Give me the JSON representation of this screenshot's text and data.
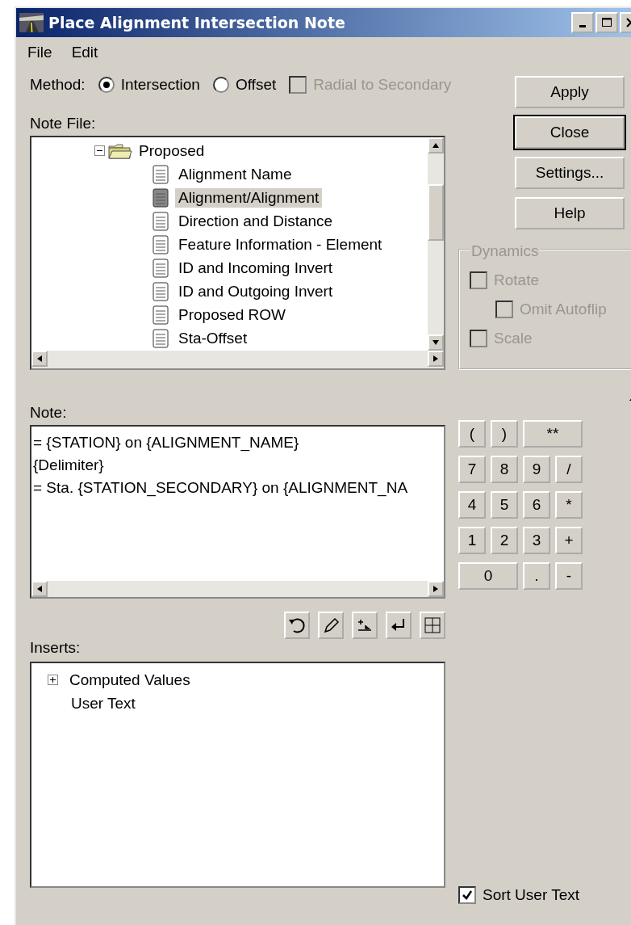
{
  "window": {
    "title": "Place Alignment Intersection Note"
  },
  "menu": [
    "File",
    "Edit"
  ],
  "method": {
    "label": "Method:",
    "options": [
      {
        "label": "Intersection",
        "selected": true
      },
      {
        "label": "Offset",
        "selected": false
      }
    ],
    "radial": {
      "label": "Radial to Secondary",
      "checked": false,
      "disabled": true
    }
  },
  "note_file": {
    "label": "Note File:",
    "tree": [
      {
        "label": "Proposed",
        "expanded": true,
        "children": [
          {
            "label": "Alignment Name",
            "selected": false
          },
          {
            "label": "Alignment/Alignment",
            "selected": true
          },
          {
            "label": "Direction and Distance",
            "selected": false
          },
          {
            "label": "Feature Information - Element",
            "selected": false
          },
          {
            "label": "ID and Incoming Invert",
            "selected": false
          },
          {
            "label": "ID and Outgoing Invert",
            "selected": false
          },
          {
            "label": "Proposed ROW",
            "selected": false
          },
          {
            "label": "Sta-Offset",
            "selected": false
          }
        ]
      }
    ]
  },
  "buttons": [
    {
      "label": "Apply",
      "default": false
    },
    {
      "label": "Close",
      "default": true
    },
    {
      "label": "Settings...",
      "default": false
    },
    {
      "label": "Help",
      "default": false
    }
  ],
  "dynamics": {
    "title": "Dynamics",
    "options": [
      {
        "label": "Rotate",
        "checked": false,
        "disabled": true,
        "children": [
          {
            "label": "Omit Autoflip",
            "checked": false,
            "disabled": true
          }
        ]
      },
      {
        "label": "Scale",
        "checked": false,
        "disabled": true
      }
    ]
  },
  "note": {
    "label": "Note:",
    "lines": [
      "= {STATION} on {ALIGNMENT_NAME}",
      "{Delimiter}",
      "= Sta. {STATION_SECONDARY} on {ALIGNMENT_NA"
    ]
  },
  "keypad": [
    [
      "(",
      ")",
      "**"
    ],
    [
      "7",
      "8",
      "9",
      "/"
    ],
    [
      "4",
      "5",
      "6",
      "*"
    ],
    [
      "1",
      "2",
      "3",
      "+"
    ],
    [
      "0",
      ".",
      "-"
    ]
  ],
  "inserts": {
    "label": "Inserts:",
    "items": [
      {
        "label": "Computed Values",
        "expanded": false
      },
      {
        "label": "User Text"
      }
    ]
  },
  "sort_user_text": {
    "label": "Sort User Text",
    "checked": true
  }
}
